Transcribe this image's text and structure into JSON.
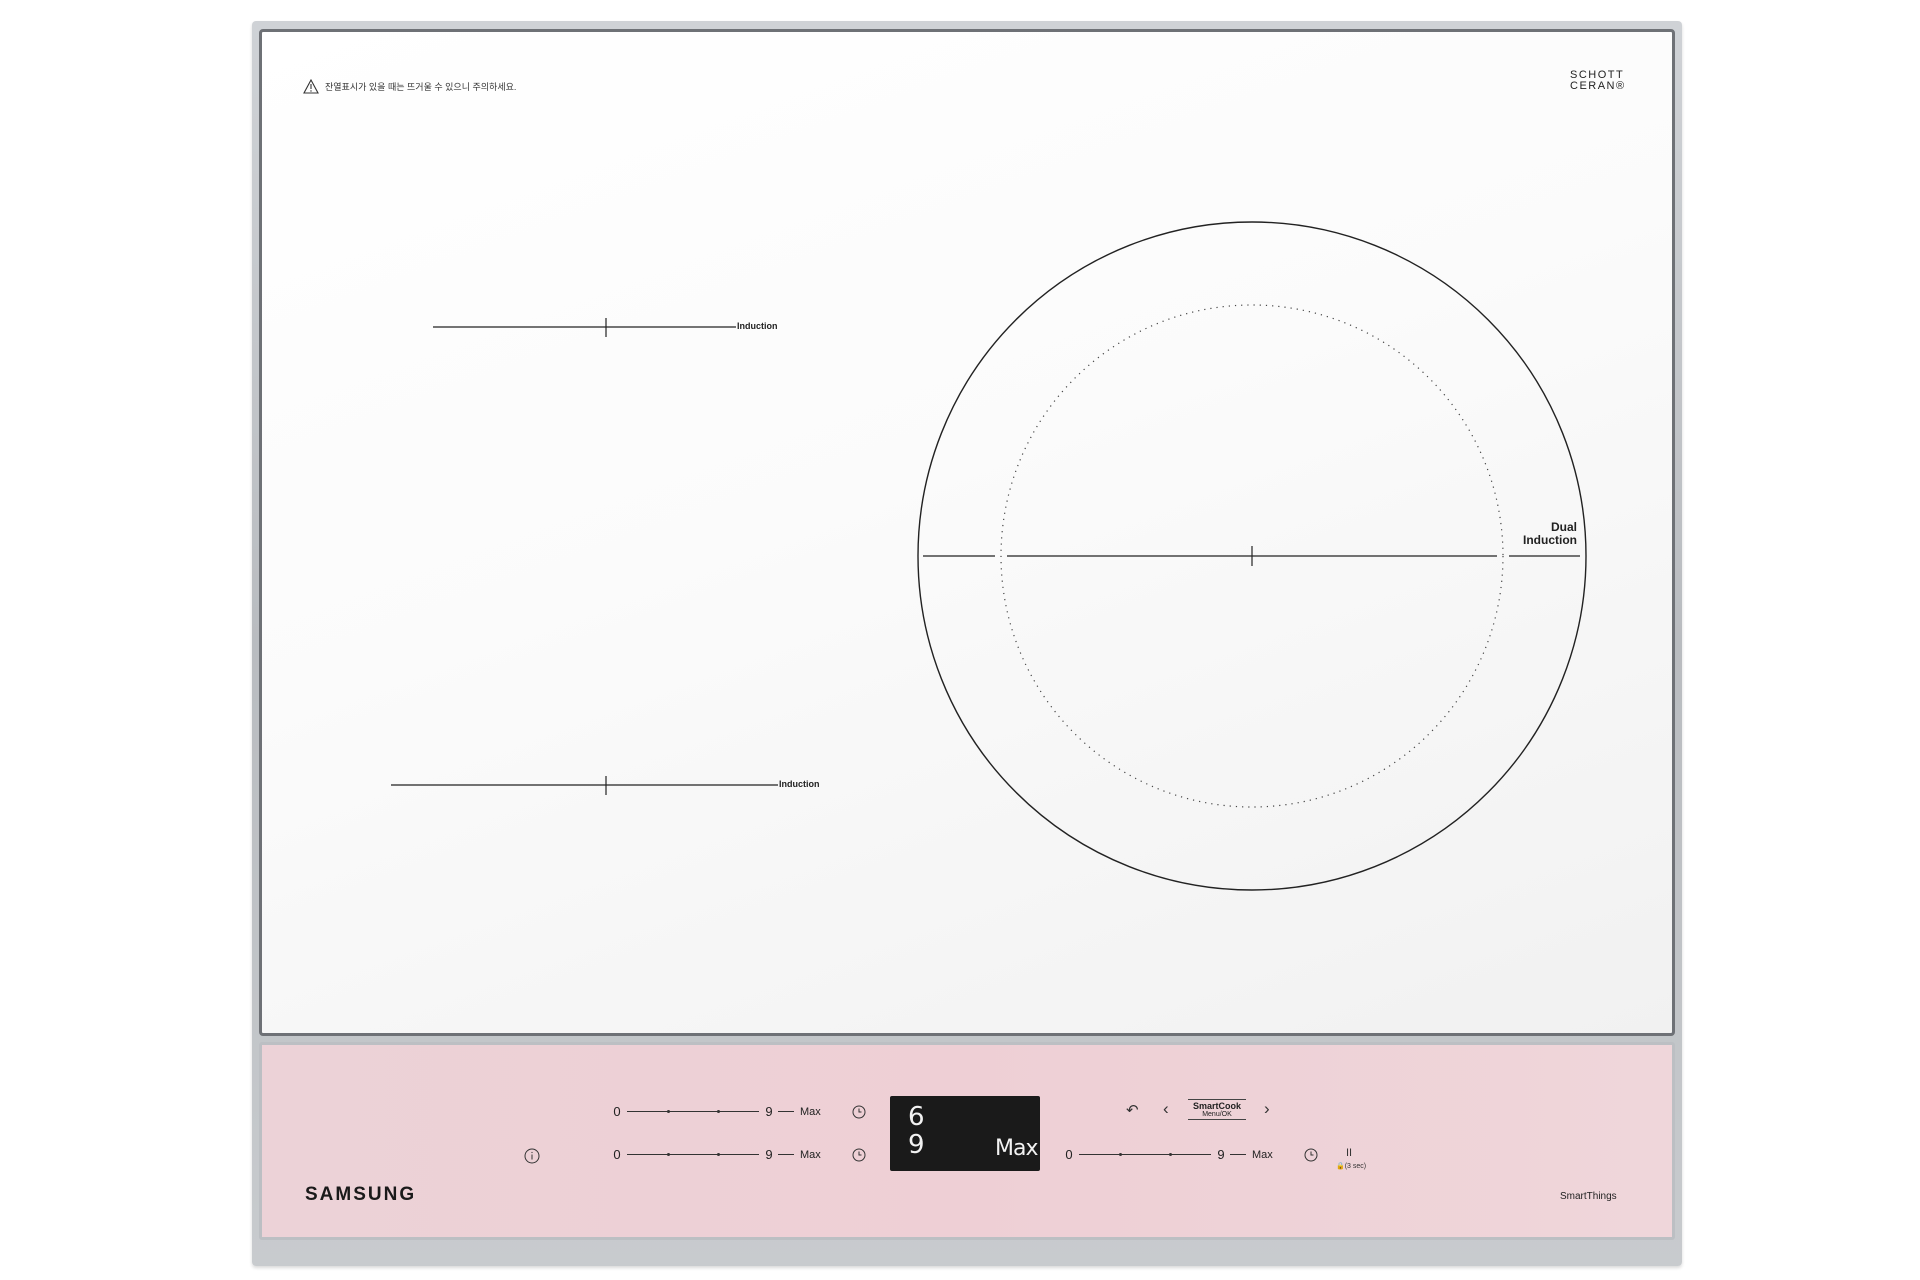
{
  "cooktop": {
    "warning_text": "잔열표시가 있을 때는 뜨거울 수 있으니 주의하세요.",
    "brand_glass_line1": "SCHOTT",
    "brand_glass_line2": "CERAN®",
    "zone_left_top_label": "Induction",
    "zone_left_bottom_label": "Induction",
    "zone_right_label_line1": "Dual",
    "zone_right_label_line2": "Induction"
  },
  "controls": {
    "slider_min_label": "0",
    "slider_mid_label": "9",
    "slider_max_label": "Max",
    "display_line1": "6",
    "display_line2": "9",
    "display_level": "Max",
    "smartcook_label": "SmartCook",
    "menu_ok_label": "Menu/OK",
    "back_glyph": "↶",
    "prev_glyph": "‹",
    "next_glyph": "›",
    "pause_glyph": "II",
    "lock_hint": "🔒(3 sec)",
    "brand": "SAMSUNG",
    "smartthings_label": "SmartThings"
  },
  "icons": [
    "warning-icon",
    "timer-icon",
    "info-icon",
    "back-icon",
    "chevron-left-icon",
    "chevron-right-icon",
    "pause-icon",
    "lock-icon"
  ],
  "colors": {
    "panel_pink": "#eed1d6",
    "frame_silver": "#c2c5c9",
    "display_bg": "#1a1a1a"
  }
}
